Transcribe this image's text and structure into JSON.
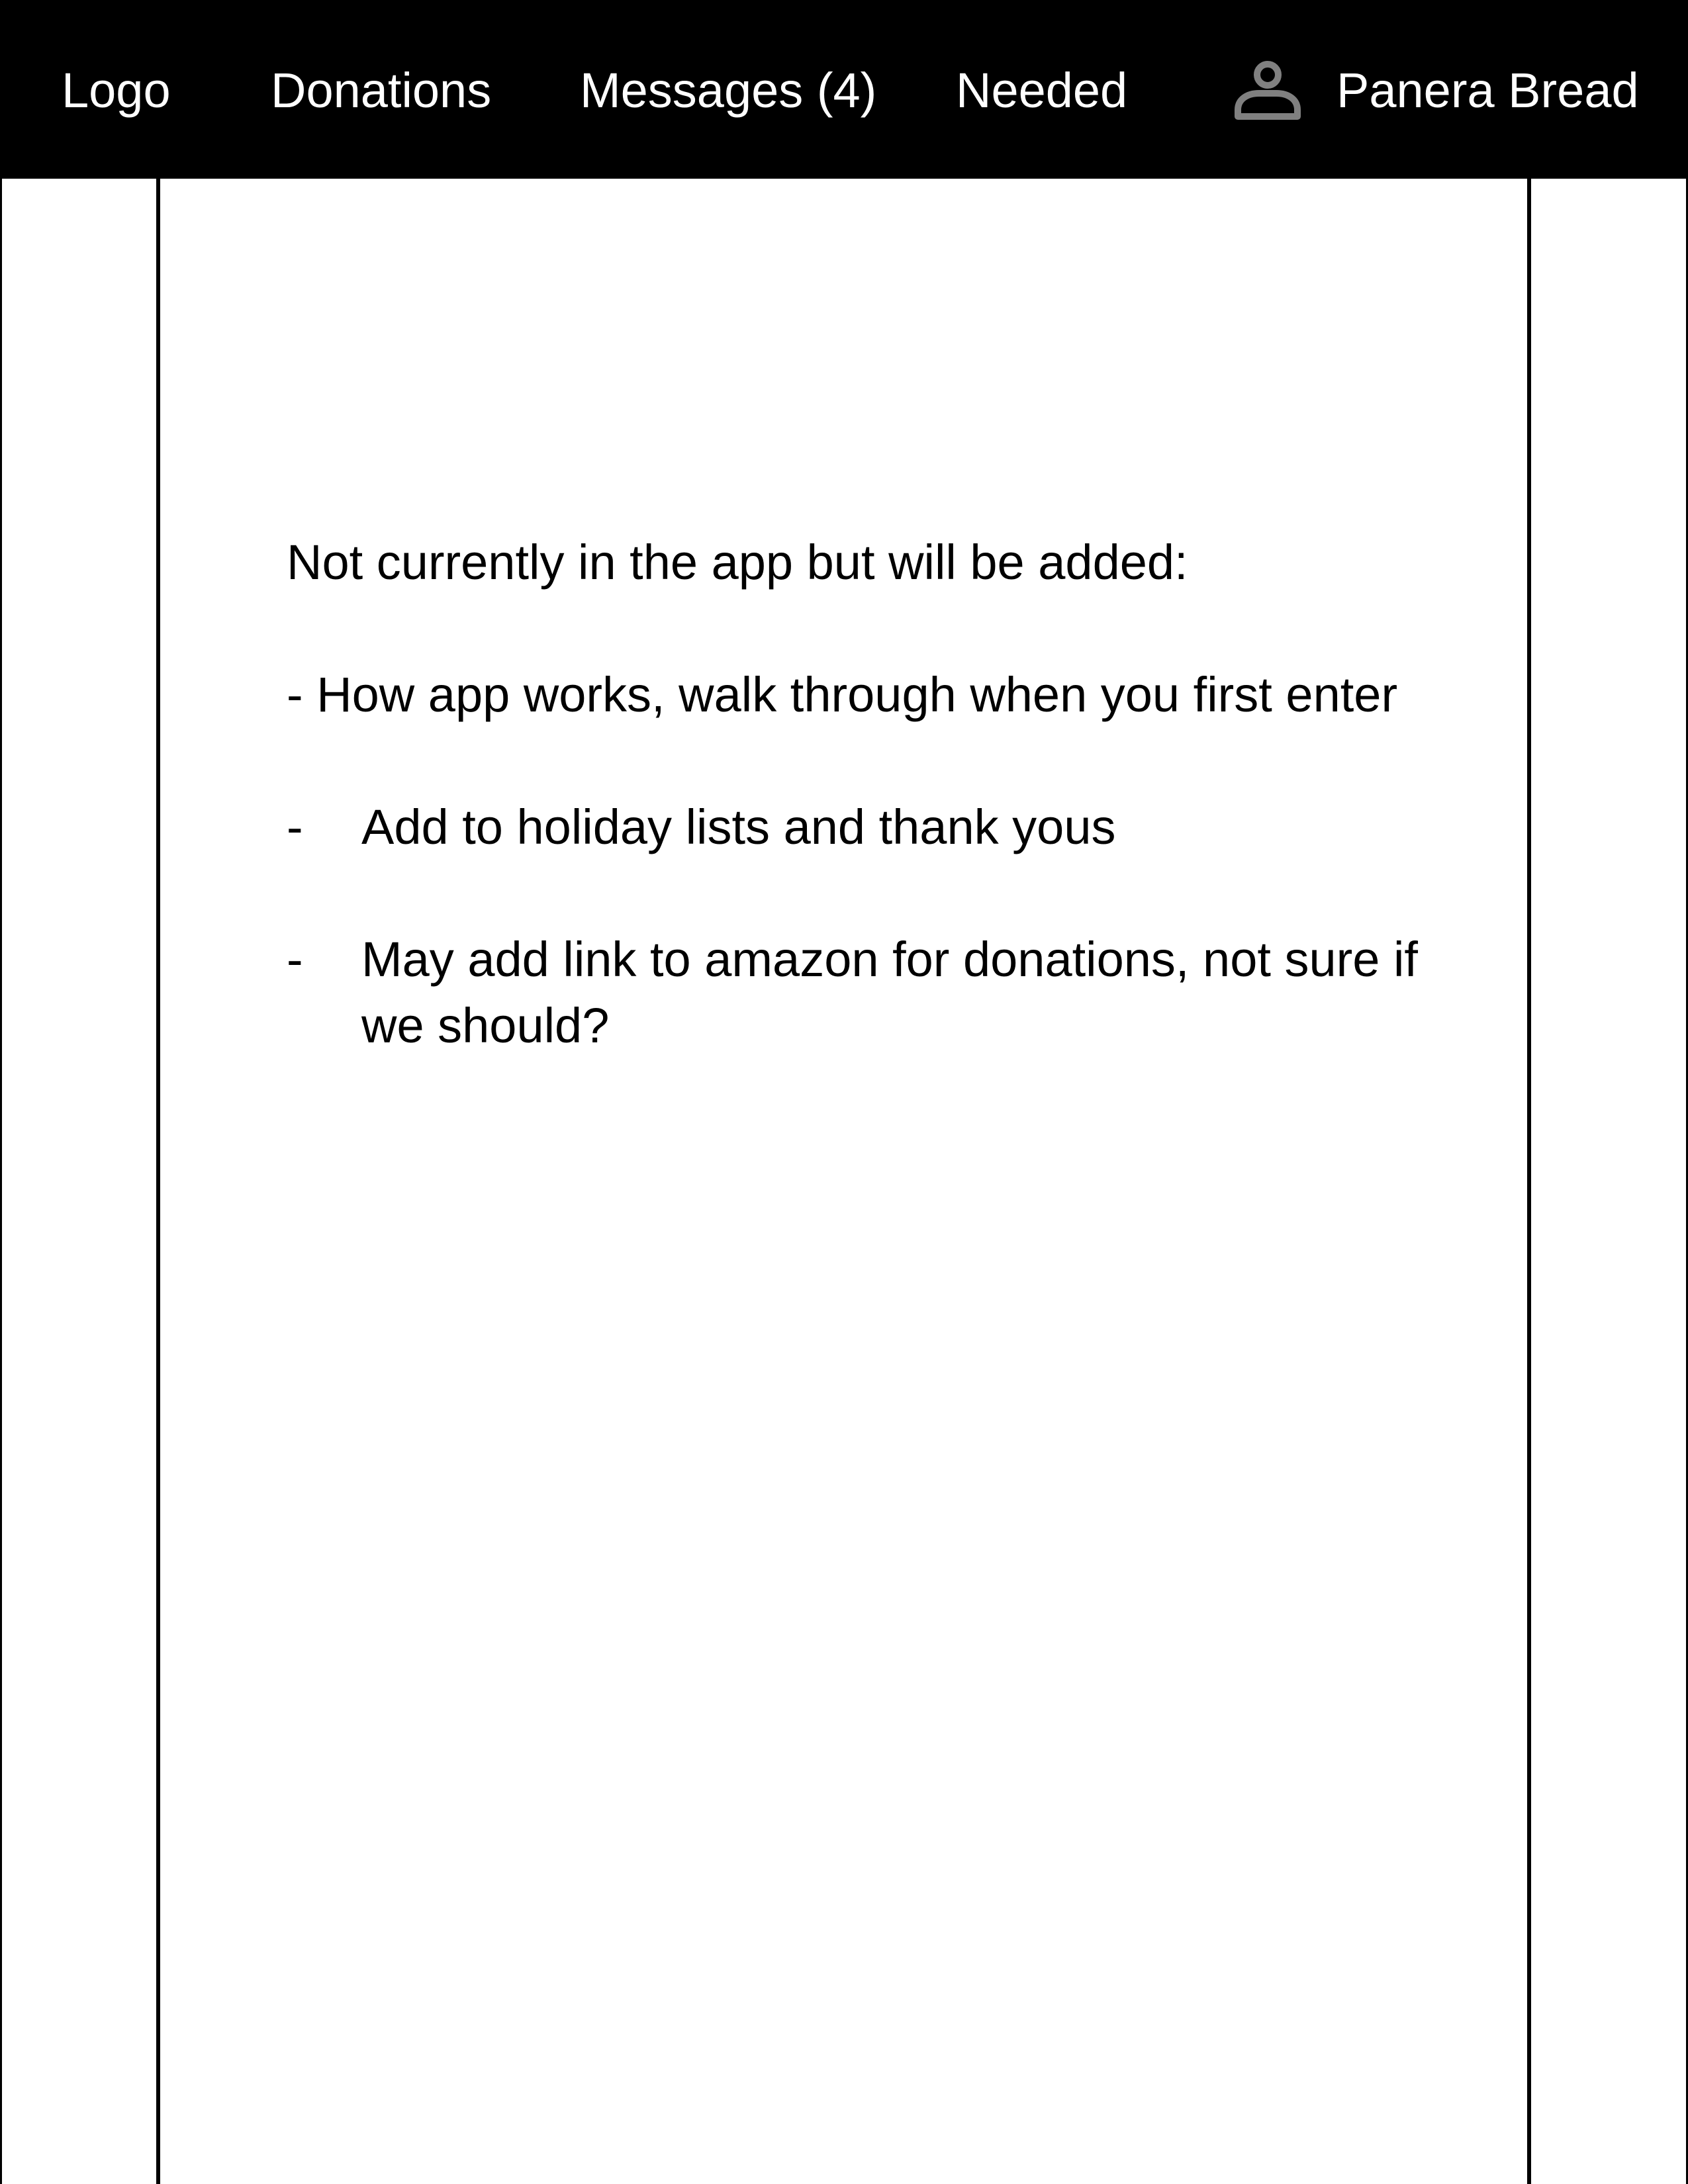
{
  "nav": {
    "logo": "Logo",
    "donations": "Donations",
    "messages": "Messages (4)",
    "needed": "Needed",
    "account_name": "Panera Bread",
    "account_icon": "user-icon"
  },
  "notes": {
    "intro": "Not currently in the app but will be added:",
    "item_1": "- How app works, walk through when you first enter",
    "bullet_marker": "-",
    "item_2": "Add to holiday lists and thank yous",
    "item_3": "May add link to amazon for donations, not sure if we should?"
  },
  "colors": {
    "topbar": "#000000",
    "nav_text": "#ffffff",
    "icon": "#808080",
    "background": "#ffffff",
    "lines": "#000000"
  }
}
